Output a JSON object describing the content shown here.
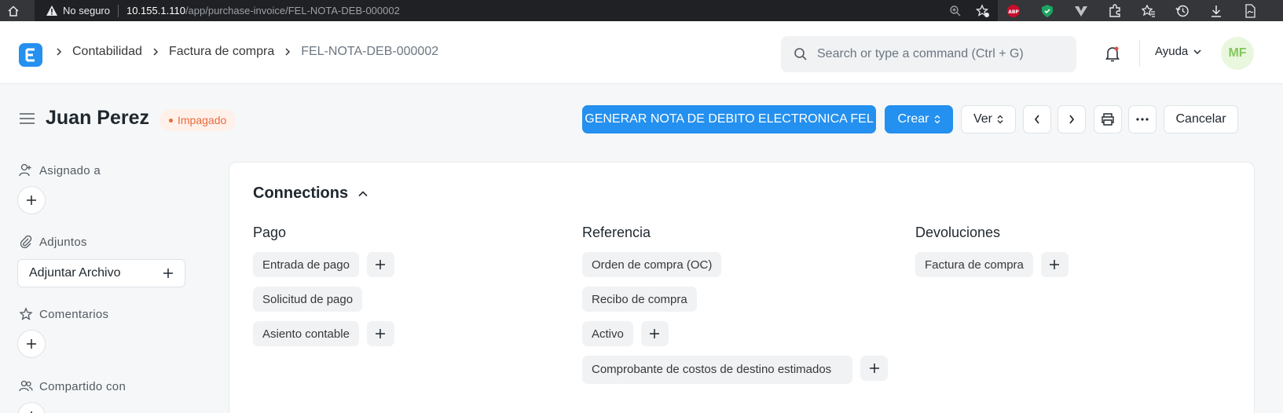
{
  "browser": {
    "security_label": "No seguro",
    "url_host": "10.155.1.110",
    "url_path": "/app/purchase-invoice/FEL-NOTA-DEB-000002",
    "extensions": [
      "abp-icon",
      "shield-check-icon",
      "vpn-icon",
      "puzzle-icon",
      "favorites-icon",
      "history-icon",
      "download-icon",
      "pdf-icon"
    ],
    "abp_label": "ABP"
  },
  "navbar": {
    "breadcrumbs": [
      "Contabilidad",
      "Factura de compra",
      "FEL-NOTA-DEB-000002"
    ],
    "search_placeholder": "Search or type a command (Ctrl + G)",
    "help_label": "Ayuda",
    "avatar_initials": "MF"
  },
  "page": {
    "title": "Juan Perez",
    "status": "Impagado"
  },
  "actions": {
    "generate_label": "GENERAR NOTA DE DEBITO ELECTRONICA FEL",
    "create_label": "Crear",
    "view_label": "Ver",
    "cancel_label": "Cancelar"
  },
  "sidebar": {
    "assigned_label": "Asignado a",
    "attachments_label": "Adjuntos",
    "attach_file_label": "Adjuntar Archivo",
    "comments_label": "Comentarios",
    "shared_label": "Compartido con"
  },
  "connections": {
    "title": "Connections",
    "columns": [
      {
        "title": "Pago",
        "items": [
          {
            "label": "Entrada de pago",
            "add": true
          },
          {
            "label": "Solicitud de pago",
            "add": false
          },
          {
            "label": "Asiento contable",
            "add": true
          }
        ]
      },
      {
        "title": "Referencia",
        "items": [
          {
            "label": "Orden de compra (OC)",
            "add": false
          },
          {
            "label": "Recibo de compra",
            "add": false
          },
          {
            "label": "Activo",
            "add": true
          },
          {
            "label": "Comprobante de costos de destino estimados",
            "add": true
          }
        ]
      },
      {
        "title": "Devoluciones",
        "items": [
          {
            "label": "Factura de compra",
            "add": true
          }
        ]
      }
    ]
  },
  "colors": {
    "primary": "#2490ef",
    "status": "#e86c3b",
    "avatar_bg": "#e9f7df",
    "avatar_fg": "#83c85a"
  }
}
